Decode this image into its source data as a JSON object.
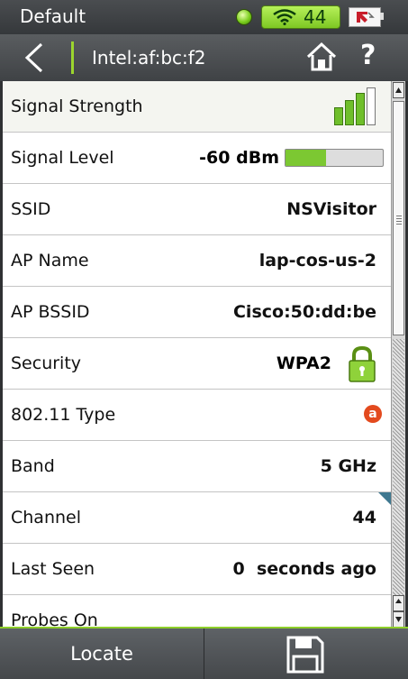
{
  "status_bar": {
    "title": "Default",
    "wifi_count": "44"
  },
  "nav": {
    "title": "Intel:af:bc:f2",
    "help": "?"
  },
  "rows": {
    "signal_strength": {
      "label": "Signal Strength"
    },
    "signal_level": {
      "label": "Signal Level",
      "value": "-60 dBm",
      "level_fraction": 0.42
    },
    "ssid": {
      "label": "SSID",
      "value": "NSVisitor"
    },
    "ap_name": {
      "label": "AP Name",
      "value": "lap-cos-us-2"
    },
    "ap_bssid": {
      "label": "AP BSSID",
      "value": "Cisco:50:dd:be"
    },
    "security": {
      "label": "Security",
      "value": "WPA2"
    },
    "type_80211": {
      "label": "802.11 Type",
      "badge": "a"
    },
    "band": {
      "label": "Band",
      "value": "5 GHz"
    },
    "channel": {
      "label": "Channel",
      "value": "44"
    },
    "last_seen": {
      "label": "Last Seen",
      "value": "0  seconds ago"
    },
    "probes_on": {
      "label": "Probes On"
    }
  },
  "footer": {
    "locate_label": "Locate"
  },
  "colors": {
    "accent_green": "#7cc832",
    "badge_orange": "#e34a1e",
    "header_gray": "#4a4d50"
  },
  "icons": {
    "back": "chevron-left-icon",
    "home": "home-icon",
    "save": "floppy-disk-icon",
    "lock": "lock-icon",
    "wifi": "wifi-icon",
    "battery": "battery-icon"
  }
}
